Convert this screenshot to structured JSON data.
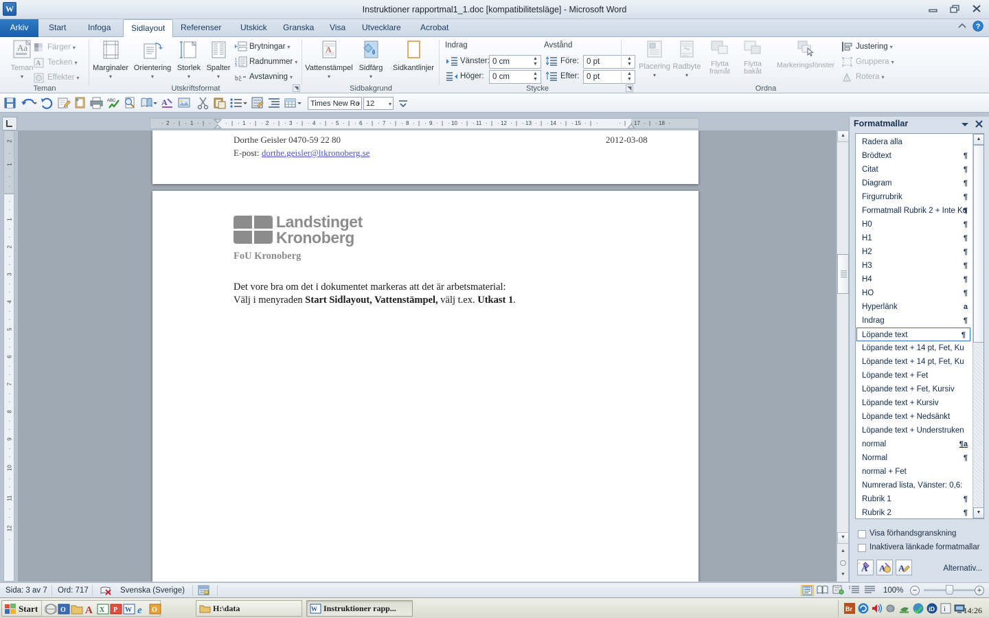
{
  "window": {
    "title": "Instruktioner rapportmal1_1.doc [kompatibilitetsläge]  -  Microsoft Word",
    "app_icon": "word-icon",
    "minimize": "minimize-icon",
    "restore": "restore-icon",
    "close": "close-icon",
    "collapse_ribbon": "chevron-up-icon",
    "help": "help-icon"
  },
  "tabs": [
    {
      "label": "Arkiv",
      "type": "file"
    },
    {
      "label": "Start",
      "type": "normal"
    },
    {
      "label": "Infoga",
      "type": "normal"
    },
    {
      "label": "Sidlayout",
      "type": "active"
    },
    {
      "label": "Referenser",
      "type": "normal"
    },
    {
      "label": "Utskick",
      "type": "normal"
    },
    {
      "label": "Granska",
      "type": "normal"
    },
    {
      "label": "Visa",
      "type": "normal"
    },
    {
      "label": "Utvecklare",
      "type": "normal"
    },
    {
      "label": "Acrobat",
      "type": "normal"
    }
  ],
  "ribbon": {
    "groups": [
      {
        "name": "Teman"
      },
      {
        "name": "Utskriftsformat"
      },
      {
        "name": "Sidbakgrund"
      },
      {
        "name": "Stycke"
      },
      {
        "name": "Ordna"
      }
    ],
    "teman": {
      "main_label": "Teman",
      "items": [
        {
          "label": "Färger",
          "icon": "colors-icon",
          "disabled": true
        },
        {
          "label": "Tecken",
          "icon": "font-icon",
          "disabled": true
        },
        {
          "label": "Effekter",
          "icon": "effects-icon",
          "disabled": true
        }
      ]
    },
    "utskriftsformat": {
      "big": [
        {
          "label": "Marginaler",
          "icon": "margins-icon"
        },
        {
          "label": "Orientering",
          "icon": "orientation-icon"
        },
        {
          "label": "Storlek",
          "icon": "size-icon"
        },
        {
          "label": "Spalter",
          "icon": "columns-icon"
        }
      ],
      "small": [
        {
          "label": "Brytningar",
          "icon": "breaks-icon"
        },
        {
          "label": "Radnummer",
          "icon": "line-numbers-icon"
        },
        {
          "label": "Avstavning",
          "icon": "hyphenation-icon"
        }
      ]
    },
    "sidbakgrund": {
      "big": [
        {
          "label": "Vattenstämpel",
          "icon": "watermark-icon"
        },
        {
          "label": "Sidfärg",
          "icon": "page-color-icon"
        },
        {
          "label": "Sidkantlinjer",
          "icon": "page-borders-icon"
        }
      ]
    },
    "stycke": {
      "indrag_header": "Indrag",
      "avstand_header": "Avstånd",
      "fields": [
        {
          "label": "Vänster:",
          "value": "0 cm",
          "icon": "indent-left-icon"
        },
        {
          "label": "Höger:",
          "value": "0 cm",
          "icon": "indent-right-icon"
        },
        {
          "label": "Före:",
          "value": "0 pt",
          "icon": "space-before-icon"
        },
        {
          "label": "Efter:",
          "value": "0 pt",
          "icon": "space-after-icon"
        }
      ]
    },
    "ordna": {
      "big": [
        {
          "label": "Placering",
          "icon": "position-icon",
          "disabled": true
        },
        {
          "label": "Radbyte",
          "icon": "wrap-text-icon",
          "disabled": true
        },
        {
          "label": "Flytta framåt",
          "icon": "bring-forward-icon",
          "disabled": true
        },
        {
          "label": "Flytta bakåt",
          "icon": "send-backward-icon",
          "disabled": true
        },
        {
          "label": "Markeringsfönster",
          "icon": "selection-pane-icon",
          "disabled": true
        }
      ],
      "small": [
        {
          "label": "Justering",
          "icon": "align-icon",
          "disabled": false
        },
        {
          "label": "Gruppera",
          "icon": "group-icon",
          "disabled": true
        },
        {
          "label": "Rotera",
          "icon": "rotate-icon",
          "disabled": true
        }
      ]
    }
  },
  "quick_toolbar": {
    "icons": [
      "save-icon",
      "undo-icon",
      "redo-icon",
      "edit-icon",
      "new-icon",
      "print-icon",
      "spelling-icon",
      "print-preview-icon",
      "copy-format-icon",
      "highlight-icon",
      "insert-picture-icon",
      "cut-icon",
      "paste-icon",
      "bullets-icon",
      "format-painter-icon",
      "indent-icon",
      "table-icon",
      "font-color-icon"
    ],
    "font_name": "Times New Ro",
    "font_size": "12",
    "overflow": "toolbar-overflow-icon"
  },
  "ruler": {
    "horizontal_ticks": [
      "2",
      "1",
      "1",
      "2",
      "3",
      "4",
      "5",
      "6",
      "7",
      "8",
      "9",
      "10",
      "11",
      "12",
      "13",
      "14",
      "15",
      "17",
      "18"
    ],
    "vertical_ticks": [
      "2",
      "1",
      "1",
      "2",
      "3",
      "4",
      "5",
      "6",
      "7",
      "8",
      "9",
      "10",
      "11",
      "12"
    ],
    "corner_icon": "tab-stop-icon"
  },
  "document": {
    "header": {
      "left_line1": "Dorthe Geisler 0470-59 22 80",
      "left_line2_label": "E-post: ",
      "left_line2_link": "dorthe.geisler@ltkronoberg.se",
      "right_date": "2012-03-08"
    },
    "logo": {
      "line1": "Landstinget",
      "line2": "Kronoberg",
      "color": "#8c8c8c"
    },
    "subtitle": "FoU Kronoberg",
    "body": [
      {
        "text": "Det vore bra om det i dokumentet markeras att det är arbetsmaterial:"
      },
      {
        "prefix": "Välj i menyraden ",
        "bold1": "Start Sidlayout, Vattenstämpel,",
        "middle": " välj t.ex. ",
        "bold2": "Utkast 1",
        "suffix": "."
      }
    ]
  },
  "styles_pane": {
    "title": "Formatmallar",
    "dropdown_icon": "chevron-down-icon",
    "close_icon": "close-icon",
    "items": [
      {
        "label": "Radera alla",
        "mark": ""
      },
      {
        "label": "Brödtext",
        "mark": "¶"
      },
      {
        "label": "Citat",
        "mark": "¶"
      },
      {
        "label": "Diagram",
        "mark": "¶"
      },
      {
        "label": "Firgurrubrik",
        "mark": "¶"
      },
      {
        "label": "Formatmall Rubrik 2 + Inte Ku",
        "mark": "¶"
      },
      {
        "label": "H0",
        "mark": "¶"
      },
      {
        "label": "H1",
        "mark": "¶"
      },
      {
        "label": "H2",
        "mark": "¶"
      },
      {
        "label": "H3",
        "mark": "¶"
      },
      {
        "label": "H4",
        "mark": "¶"
      },
      {
        "label": "HO",
        "mark": "¶"
      },
      {
        "label": "Hyperlänk",
        "mark": "a"
      },
      {
        "label": "Indrag",
        "mark": "¶"
      },
      {
        "label": "Löpande text",
        "mark": "¶",
        "selected": true
      },
      {
        "label": "Löpande text + 14 pt, Fet, Ku",
        "mark": ""
      },
      {
        "label": "Löpande text + 14 pt, Fet, Ku",
        "mark": ""
      },
      {
        "label": "Löpande text + Fet",
        "mark": ""
      },
      {
        "label": "Löpande text + Fet, Kursiv",
        "mark": ""
      },
      {
        "label": "Löpande text + Kursiv",
        "mark": ""
      },
      {
        "label": "Löpande text + Nedsänkt",
        "mark": ""
      },
      {
        "label": "Löpande text + Understruken",
        "mark": ""
      },
      {
        "label": "normal",
        "mark": "¶a"
      },
      {
        "label": "Normal",
        "mark": "¶"
      },
      {
        "label": "normal + Fet",
        "mark": ""
      },
      {
        "label": "Numrerad lista, Vänster:  0,6:",
        "mark": ""
      },
      {
        "label": "Rubrik 1",
        "mark": "¶"
      },
      {
        "label": "Rubrik 2",
        "mark": "¶"
      }
    ],
    "checkboxes": [
      {
        "label": "Visa förhandsgranskning",
        "checked": false
      },
      {
        "label": "Inaktivera länkade formatmallar",
        "checked": false
      }
    ],
    "footer_buttons": [
      "new-style-icon",
      "style-inspector-icon",
      "manage-styles-icon"
    ],
    "options_label": "Alternativ..."
  },
  "status_bar": {
    "page": "Sida: 3 av 7",
    "words": "Ord: 717",
    "proofing_icon": "proofing-errors-icon",
    "language": "Svenska (Sverige)",
    "macro_icon": "record-macro-icon",
    "view_buttons": [
      "print-layout-icon",
      "full-screen-reading-icon",
      "web-layout-icon",
      "outline-icon",
      "draft-icon"
    ],
    "zoom": "100%",
    "zoom_out_icon": "zoom-out-icon",
    "zoom_in_icon": "zoom-in-icon"
  },
  "taskbar": {
    "start_label": "Start",
    "quick_launch": [
      "show-desktop-icon",
      "outlook-icon",
      "folder-icon",
      "acrobat-icon",
      "excel-icon",
      "powerpoint-icon",
      "word-icon",
      "ie-icon",
      "onenote-icon"
    ],
    "items": [
      {
        "label": "H:\\data",
        "icon": "folder-icon",
        "active": false
      },
      {
        "label": "Instruktioner rapp...",
        "icon": "word-icon",
        "active": true
      }
    ],
    "tray_icons": [
      "bridge-icon",
      "sync-icon",
      "volume-icon",
      "network-icon",
      "printer-icon",
      "antivirus-icon",
      "id-icon",
      "update-icon",
      "display-icon"
    ],
    "clock": "14:26"
  }
}
